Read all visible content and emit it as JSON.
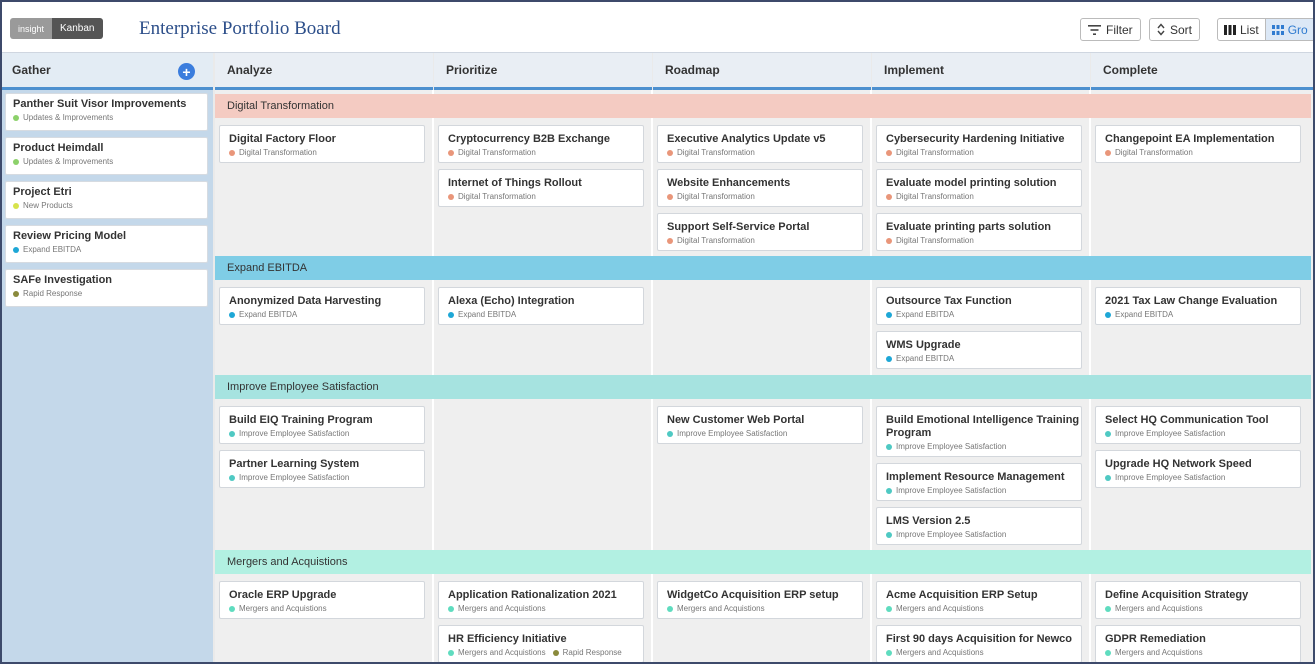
{
  "header": {
    "toggle_insight": "insight",
    "toggle_kanban": "Kanban",
    "title": "Enterprise Portfolio Board",
    "filter_label": "Filter",
    "sort_label": "Sort",
    "list_label": "List",
    "grid_label": "Gro"
  },
  "gather": {
    "label": "Gather",
    "add_symbol": "+",
    "cards": [
      {
        "title": "Panther Suit Visor Improvements",
        "tag": "Updates & Improvements",
        "color": "#8cd16a"
      },
      {
        "title": "Product Heimdall",
        "tag": "Updates & Improvements",
        "color": "#8cd16a"
      },
      {
        "title": "Project Etri",
        "tag": "New Products",
        "color": "#d7e34c"
      },
      {
        "title": "Review Pricing Model",
        "tag": "Expand EBITDA",
        "color": "#1ea7d6"
      },
      {
        "title": "SAFe Investigation",
        "tag": "Rapid Response",
        "color": "#8a8a3c"
      }
    ]
  },
  "columns": [
    "Analyze",
    "Prioritize",
    "Roadmap",
    "Implement",
    "Complete"
  ],
  "lanes": [
    {
      "label": "Digital Transformation",
      "bg": "#f4cbc2",
      "dot": "#e9967a",
      "cells": [
        [
          {
            "title": "Digital Factory Floor",
            "tag": "Digital Transformation"
          }
        ],
        [
          {
            "title": "Cryptocurrency B2B Exchange",
            "tag": "Digital Transformation"
          },
          {
            "title": "Internet of Things Rollout",
            "tag": "Digital Transformation"
          }
        ],
        [
          {
            "title": "Executive Analytics Update v5",
            "tag": "Digital Transformation"
          },
          {
            "title": "Website Enhancements",
            "tag": "Digital Transformation"
          },
          {
            "title": "Support Self-Service Portal",
            "tag": "Digital Transformation"
          }
        ],
        [
          {
            "title": "Cybersecurity Hardening Initiative",
            "tag": "Digital Transformation"
          },
          {
            "title": "Evaluate model printing solution",
            "tag": "Digital Transformation"
          },
          {
            "title": "Evaluate printing parts solution",
            "tag": "Digital Transformation"
          }
        ],
        [
          {
            "title": "Changepoint EA Implementation",
            "tag": "Digital Transformation"
          }
        ]
      ]
    },
    {
      "label": "Expand EBITDA",
      "bg": "#7fcde6",
      "dot": "#1ea7d6",
      "cells": [
        [
          {
            "title": "Anonymized Data Harvesting",
            "tag": "Expand EBITDA"
          }
        ],
        [
          {
            "title": "Alexa (Echo) Integration",
            "tag": "Expand EBITDA"
          }
        ],
        [],
        [
          {
            "title": "Outsource Tax Function",
            "tag": "Expand EBITDA"
          },
          {
            "title": "WMS Upgrade",
            "tag": "Expand EBITDA"
          }
        ],
        [
          {
            "title": "2021 Tax Law Change Evaluation",
            "tag": "Expand EBITDA"
          }
        ]
      ]
    },
    {
      "label": "Improve Employee Satisfaction",
      "bg": "#a6e3e0",
      "dot": "#4fc9c3",
      "cells": [
        [
          {
            "title": "Build EIQ Training Program",
            "tag": "Improve Employee Satisfaction"
          },
          {
            "title": "Partner Learning System",
            "tag": "Improve Employee Satisfaction"
          }
        ],
        [],
        [
          {
            "title": "New Customer Web Portal",
            "tag": "Improve Employee Satisfaction"
          }
        ],
        [
          {
            "title": "Build Emotional Intelligence Training Program",
            "tag": "Improve Employee Satisfaction",
            "tall": true
          },
          {
            "title": "Implement Resource Management",
            "tag": "Improve Employee Satisfaction"
          },
          {
            "title": "LMS Version 2.5",
            "tag": "Improve Employee Satisfaction"
          }
        ],
        [
          {
            "title": "Select HQ Communication Tool",
            "tag": "Improve Employee Satisfaction"
          },
          {
            "title": "Upgrade HQ Network Speed",
            "tag": "Improve Employee Satisfaction"
          }
        ]
      ]
    },
    {
      "label": "Mergers and Acquistions",
      "bg": "#b2f0e2",
      "dot": "#5fdcbf",
      "cells": [
        [
          {
            "title": "Oracle ERP Upgrade",
            "tag": "Mergers and Acquistions"
          }
        ],
        [
          {
            "title": "Application Rationalization 2021",
            "tag": "Mergers and Acquistions"
          },
          {
            "title": "HR Efficiency Initiative",
            "tag": "Mergers and Acquistions",
            "tag2": "Rapid Response",
            "tag2_color": "#8a8a3c"
          }
        ],
        [
          {
            "title": "WidgetCo Acquisition ERP setup",
            "tag": "Mergers and Acquistions"
          }
        ],
        [
          {
            "title": "Acme Acquisition ERP Setup",
            "tag": "Mergers and Acquistions"
          },
          {
            "title": "First 90 days Acquisition for Newco",
            "tag": "Mergers and Acquistions"
          }
        ],
        [
          {
            "title": "Define Acquisition Strategy",
            "tag": "Mergers and Acquistions"
          },
          {
            "title": "GDPR Remediation",
            "tag": "Mergers and Acquistions"
          }
        ]
      ]
    }
  ]
}
